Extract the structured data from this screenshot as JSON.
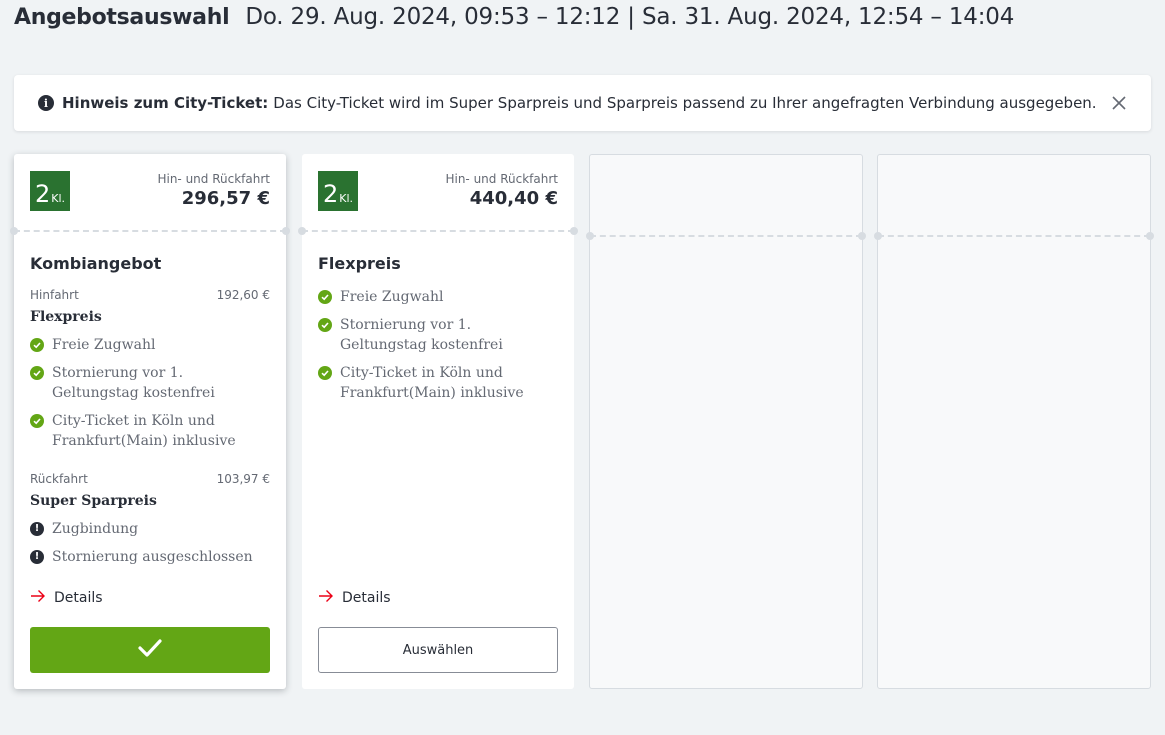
{
  "page": {
    "title": "Angebotsauswahl",
    "dates": "Do. 29. Aug. 2024, 09:53 – 12:12 | Sa. 31. Aug. 2024, 12:54 – 14:04"
  },
  "notice": {
    "title": "Hinweis zum City-Ticket:",
    "text": "Das City-Ticket wird im Super Sparpreis und Sparpreis passend zu Ihrer angefragten Verbindung ausgegeben.",
    "icon": "info-icon",
    "close_icon": "close-icon"
  },
  "colors": {
    "accent_green": "#63a615",
    "badge_green": "#2a7230",
    "link_red": "#ec0016",
    "text": "#282d37"
  },
  "offers": [
    {
      "class_num": "2",
      "class_unit": "Kl.",
      "trip_type": "Hin- und Rückfahrt",
      "total_price": "296,57 €",
      "name": "Kombiangebot",
      "selected": true,
      "outbound": {
        "label": "Hinfahrt",
        "price": "192,60 €",
        "fare": "Flexpreis",
        "features": [
          {
            "text": "Freie Zugwahl",
            "icon": "check-icon"
          },
          {
            "text": "Stornierung vor 1. Geltungstag kostenfrei",
            "icon": "check-icon"
          },
          {
            "text": "City-Ticket in Köln und Frankfurt(Main) inklusive",
            "icon": "check-icon"
          }
        ]
      },
      "return": {
        "label": "Rückfahrt",
        "price": "103,97 €",
        "fare": "Super Sparpreis",
        "features": [
          {
            "text": "Zugbindung",
            "icon": "warning-icon"
          },
          {
            "text": "Stornierung ausgeschlossen",
            "icon": "warning-icon"
          }
        ]
      },
      "details_label": "Details"
    },
    {
      "class_num": "2",
      "class_unit": "Kl.",
      "trip_type": "Hin- und Rückfahrt",
      "total_price": "440,40 €",
      "name": "Flexpreis",
      "selected": false,
      "features": [
        {
          "text": "Freie Zugwahl",
          "icon": "check-icon"
        },
        {
          "text": "Stornierung vor 1. Geltungstag kostenfrei",
          "icon": "check-icon"
        },
        {
          "text": "City-Ticket in Köln und Frankfurt(Main) inklusive",
          "icon": "check-icon"
        }
      ],
      "details_label": "Details",
      "select_label": "Auswählen"
    }
  ]
}
